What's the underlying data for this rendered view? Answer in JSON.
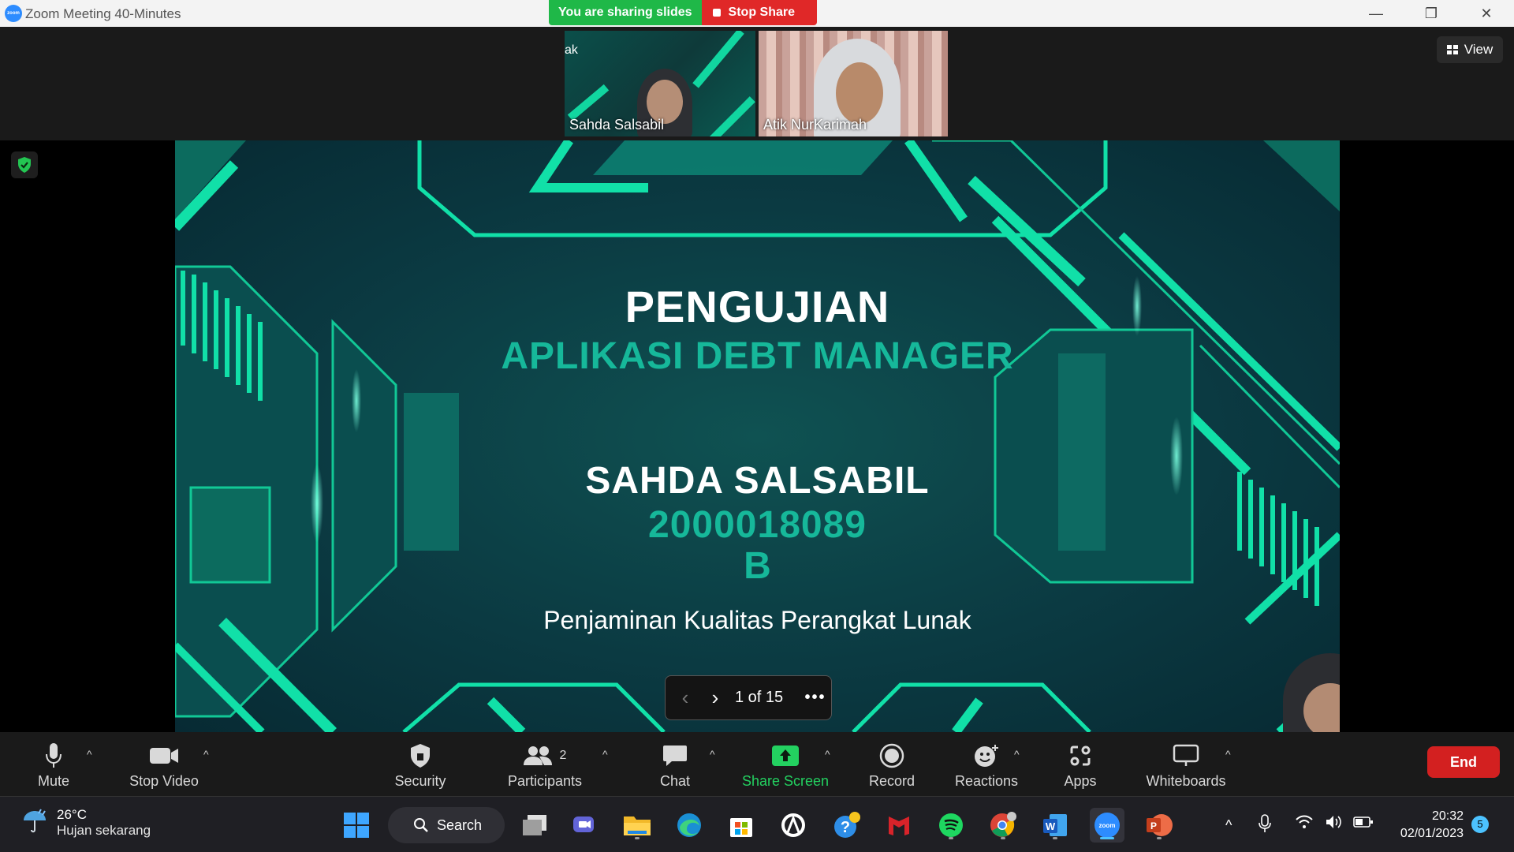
{
  "window": {
    "title": "Zoom Meeting 40-Minutes",
    "icon_text": "zoom",
    "minimize_glyph": "—",
    "maximize_glyph": "❐",
    "close_glyph": "✕"
  },
  "share_banner": {
    "status": "You are sharing slides",
    "stop_label": "Stop Share"
  },
  "gallery": {
    "partial_label": "ak",
    "participants": [
      {
        "name": "Sahda Salsabil"
      },
      {
        "name": "Atik NurKarimah"
      }
    ],
    "view_label": "View"
  },
  "slide": {
    "title": "PENGUJIAN",
    "subtitle": "APLIKASI DEBT MANAGER",
    "author": "SAHDA SALSABIL",
    "student_id": "2000018089",
    "class": "B",
    "course": "Penjaminan Kualitas Perangkat Lunak",
    "colors": {
      "accent": "#16b89a",
      "neon": "#11e0a8",
      "background": "#0b3a42"
    }
  },
  "slide_controls": {
    "prev_glyph": "‹",
    "next_glyph": "›",
    "counter": "1 of 15",
    "more_glyph": "•••"
  },
  "toolbar": {
    "mute": "Mute",
    "stop_video": "Stop Video",
    "security": "Security",
    "participants": "Participants",
    "participants_count": "2",
    "chat": "Chat",
    "share_screen": "Share Screen",
    "record": "Record",
    "reactions": "Reactions",
    "apps": "Apps",
    "whiteboards": "Whiteboards",
    "end": "End",
    "caret": "^"
  },
  "taskbar": {
    "weather_temp": "26°C",
    "weather_desc": "Hujan sekarang",
    "search_label": "Search",
    "time": "20:32",
    "date": "02/01/2023",
    "notification_count": "5",
    "tray_up_glyph": "^"
  }
}
